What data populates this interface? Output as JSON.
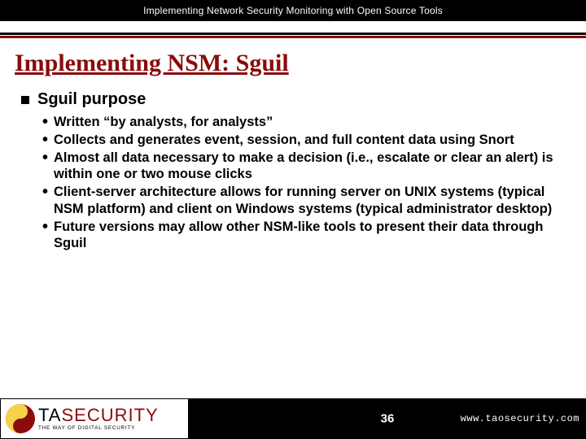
{
  "header": {
    "title": "Implementing Network Security Monitoring with Open Source Tools"
  },
  "slide": {
    "title": "Implementing NSM: Sguil",
    "section_heading": "Sguil purpose",
    "bullets": [
      "Written “by analysts, for analysts”",
      "Collects and generates event, session, and full content data using Snort",
      "Almost all data necessary to make a decision (i.e., escalate or clear an alert) is within one or two mouse clicks",
      "Client-server architecture allows for running server on UNIX systems (typical NSM platform) and client on Windows systems (typical administrator desktop)",
      "Future versions may allow other NSM-like tools to present their data through Sguil"
    ]
  },
  "footer": {
    "logo": {
      "brand_left": "TA",
      "brand_right": "SECURITY",
      "tagline": "THE WAY OF DIGITAL SECURITY"
    },
    "page_number": "36",
    "url": "www.taosecurity.com"
  }
}
